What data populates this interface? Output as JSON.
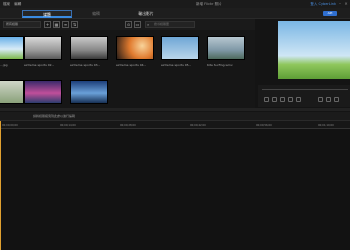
{
  "menu": [
    "檔案",
    "編輯"
  ],
  "window_title": "新增 Flickr 照片",
  "user_label": "登入 CyberLink",
  "tabs": {
    "media": "媒體",
    "edit": "編輯",
    "produce": "輸出影片"
  },
  "apis_label": "API",
  "filter_label": "所有媒體",
  "search_placeholder": "搜尋媒體庫",
  "thumbs": [
    {
      "label": "...jpg"
    },
    {
      "label": "extreme sports 02..."
    },
    {
      "label": "extreme sports 03..."
    },
    {
      "label": "extreme sports 04..."
    },
    {
      "label": "extreme sports 05..."
    },
    {
      "label": "Kite Surfing.wmv"
    },
    {
      "label": ""
    },
    {
      "label": ""
    },
    {
      "label": ""
    }
  ],
  "timeline_hint": "請將媒體拖曳到此處以進行編輯",
  "ruler": [
    "00;00;00;00",
    "00;00;14;00",
    "00;00;28;00",
    "00;00;42;00",
    "00;00;56;00",
    "00;01;10;00"
  ]
}
